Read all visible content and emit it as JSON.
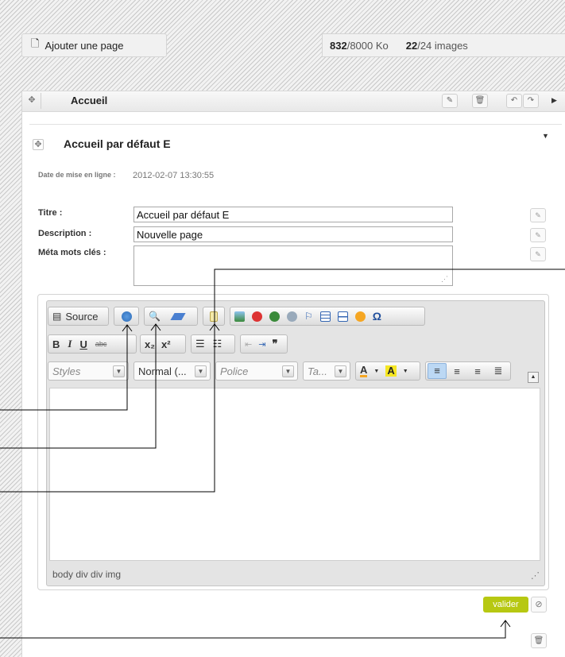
{
  "topbar": {
    "add_page_label": "Ajouter une page",
    "quota_used": "832",
    "quota_total": "/8000 Ko",
    "images_used": "22",
    "images_total": "/24 images"
  },
  "panel": {
    "title": "Accueil",
    "sub_title": "Accueil par défaut E",
    "date_label": "Date de mise en ligne :",
    "date_value": "2012-02-07 13:30:55"
  },
  "form": {
    "title_label": "Titre :",
    "title_value": "Accueil par défaut E",
    "description_label": "Description :",
    "description_value": "Nouvelle page",
    "meta_label": "Méta mots clés :",
    "meta_value": ""
  },
  "editor": {
    "source_label": "Source",
    "bold": "B",
    "italic": "I",
    "underline": "U",
    "strike": "abc",
    "subscript": "x₂",
    "superscript": "x²",
    "quote": "❞",
    "styles_combo": "Styles",
    "format_combo": "Normal (...",
    "font_combo": "Police",
    "size_combo": "Ta...",
    "text_color": "A",
    "bg_color": "A",
    "omega": "Ω",
    "path": "body  div  div  img"
  },
  "actions": {
    "valider": "valider"
  },
  "colors": {
    "valider_bg": "#b7c812",
    "pane_bg": "#e4e4e4"
  }
}
